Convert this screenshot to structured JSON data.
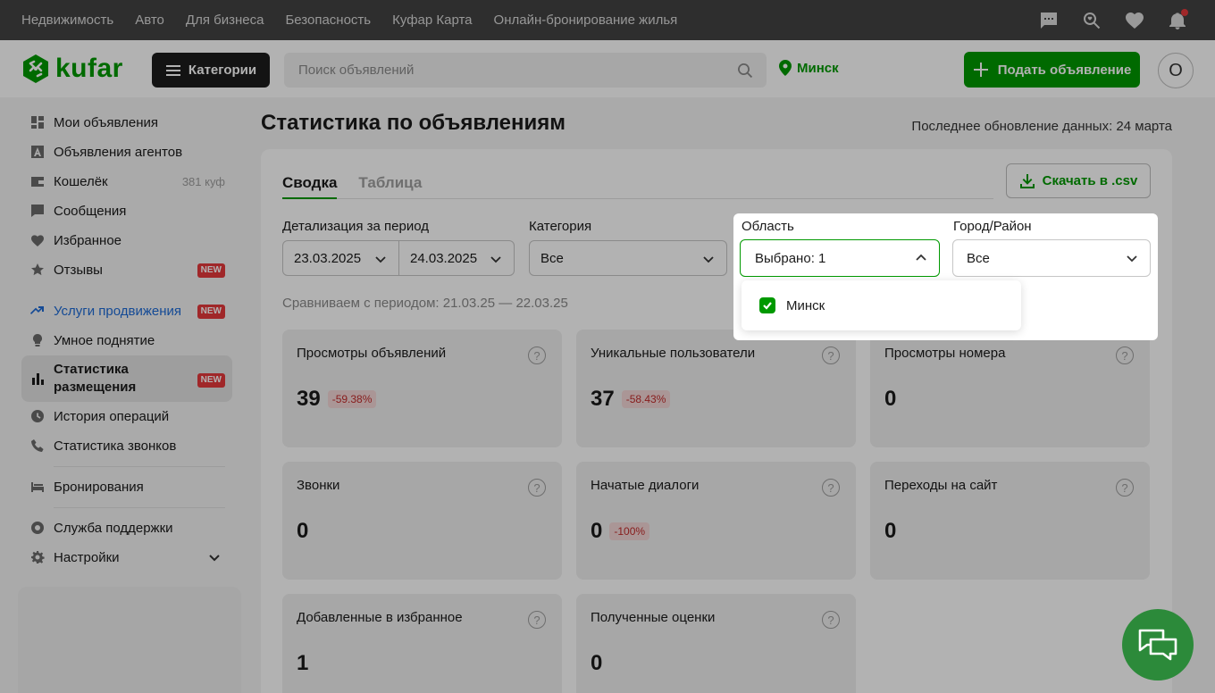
{
  "topbar": {
    "links": [
      "Недвижимость",
      "Авто",
      "Для бизнеса",
      "Безопасность",
      "Куфар Карта",
      "Онлайн-бронирование жилья"
    ]
  },
  "header": {
    "logo_text": "kufar",
    "categories_label": "Категории",
    "search_placeholder": "Поиск объявлений",
    "location": "Минск",
    "post_button": "Подать объявление",
    "avatar_letter": "О"
  },
  "sidebar": {
    "items": [
      {
        "label": "Мои объявления",
        "icon": "grid-icon"
      },
      {
        "label": "Объявления агентов",
        "icon": "agent-icon"
      },
      {
        "label": "Кошелёк",
        "icon": "wallet-icon",
        "right": "381 куф"
      },
      {
        "label": "Сообщения",
        "icon": "chat-icon"
      },
      {
        "label": "Избранное",
        "icon": "heart-icon"
      },
      {
        "label": "Отзывы",
        "icon": "star-icon",
        "badge": "NEW"
      },
      {
        "label": "Услуги продвижения",
        "icon": "trend-icon",
        "badge": "NEW"
      },
      {
        "label": "Умное поднятие",
        "icon": "bulb-icon"
      },
      {
        "label": "Статистика размещения",
        "icon": "bar-chart-icon",
        "badge": "NEW"
      },
      {
        "label": "История операций",
        "icon": "clock-icon"
      },
      {
        "label": "Статистика звонков",
        "icon": "phone-icon"
      },
      {
        "label": "Бронирования",
        "icon": "bed-icon"
      },
      {
        "label": "Служба поддержки",
        "icon": "lifebuoy-icon"
      },
      {
        "label": "Настройки",
        "icon": "gear-icon"
      }
    ]
  },
  "main": {
    "title": "Статистика по объявлениям",
    "updated": "Последнее обновление данных: 24 марта",
    "tabs": [
      "Сводка",
      "Таблица"
    ],
    "csv_button": "Скачать в .csv",
    "period_label": "Детализация за период",
    "date_from": "23.03.2025",
    "date_to": "24.03.2025",
    "category_label": "Категория",
    "category_value": "Все",
    "region_label": "Область",
    "region_value": "Выбрано: 1",
    "city_label": "Город/Район",
    "city_value": "Все",
    "dropdown_option": "Минск",
    "compare": "Сравниваем с периодом: 21.03.25 — 22.03.25",
    "help": "?",
    "cards": [
      {
        "title": "Просмотры объявлений",
        "value": "39",
        "delta": "-59.38%"
      },
      {
        "title": "Уникальные пользователи",
        "value": "37",
        "delta": "-58.43%"
      },
      {
        "title": "Просмотры номера",
        "value": "0"
      },
      {
        "title": "Звонки",
        "value": "0"
      },
      {
        "title": "Начатые диалоги",
        "value": "0",
        "delta": "-100%"
      },
      {
        "title": "Переходы на сайт",
        "value": "0"
      },
      {
        "title": "Добавленные в избранное",
        "value": "1"
      },
      {
        "title": "Полученные оценки",
        "value": "0"
      }
    ]
  },
  "colors": {
    "brand": "#009900",
    "topbar": "#424242",
    "badge": "#e5383b",
    "link_blue": "#1d6ad6"
  }
}
